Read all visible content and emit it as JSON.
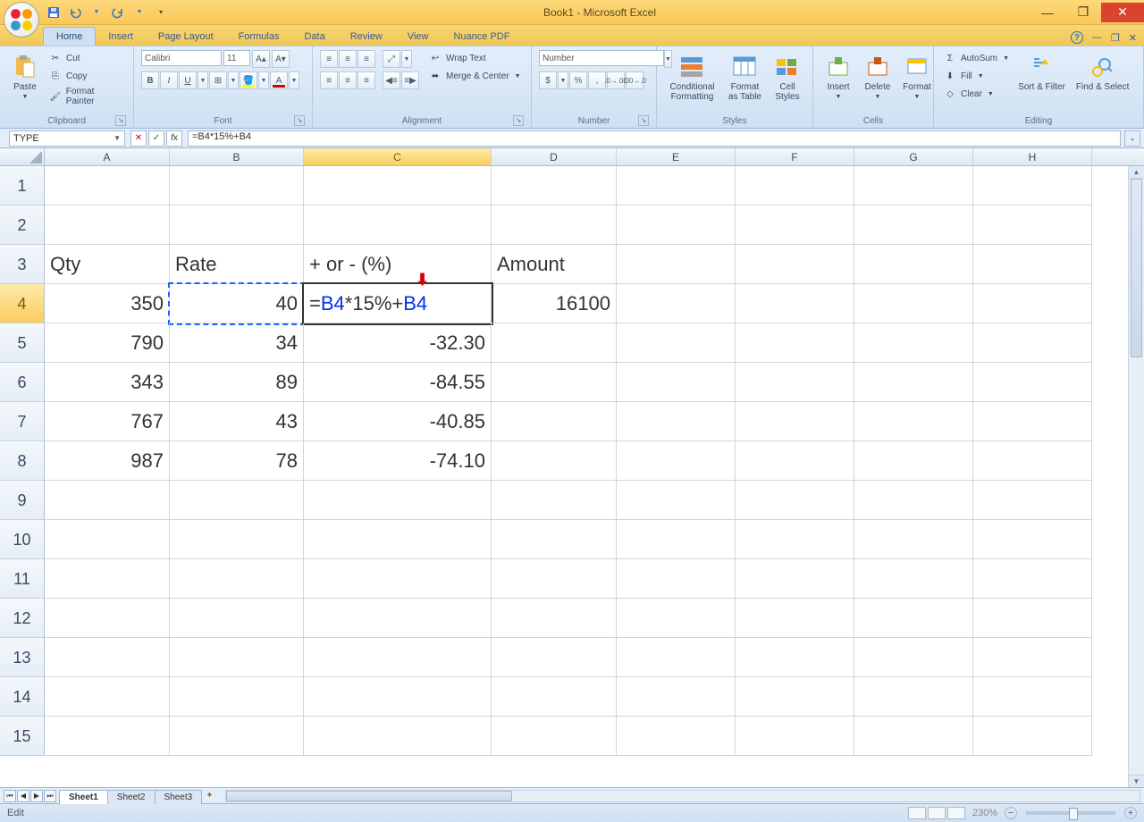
{
  "title": "Book1 - Microsoft Excel",
  "tabs": [
    "Home",
    "Insert",
    "Page Layout",
    "Formulas",
    "Data",
    "Review",
    "View",
    "Nuance PDF"
  ],
  "active_tab": "Home",
  "clipboard": {
    "cut": "Cut",
    "copy": "Copy",
    "format_painter": "Format Painter",
    "paste": "Paste",
    "label": "Clipboard"
  },
  "font": {
    "name": "Calibri",
    "size": "11",
    "label": "Font"
  },
  "alignment": {
    "wrap": "Wrap Text",
    "merge": "Merge & Center",
    "label": "Alignment"
  },
  "number": {
    "format": "Number",
    "label": "Number"
  },
  "styles": {
    "cond": "Conditional Formatting",
    "fmt": "Format as Table",
    "cell": "Cell Styles",
    "label": "Styles"
  },
  "cells": {
    "insert": "Insert",
    "delete": "Delete",
    "format": "Format",
    "label": "Cells"
  },
  "editing": {
    "autosum": "AutoSum",
    "fill": "Fill",
    "clear": "Clear",
    "sort": "Sort & Filter",
    "find": "Find & Select",
    "label": "Editing"
  },
  "namebox": "TYPE",
  "formula": "=B4*15%+B4",
  "columns": [
    "A",
    "B",
    "C",
    "D",
    "E",
    "F",
    "G",
    "H"
  ],
  "row_ids": [
    "1",
    "2",
    "3",
    "4",
    "5",
    "6",
    "7",
    "8",
    "9",
    "10",
    "11",
    "12",
    "13",
    "14",
    "15"
  ],
  "headers_row3": {
    "A": "Qty",
    "B": "Rate",
    "C": "+ or - (%)",
    "D": "Amount"
  },
  "data": {
    "4": {
      "A": "350",
      "B": "40",
      "C": "=B4*15%+B4",
      "D": "16100"
    },
    "5": {
      "A": "790",
      "B": "34",
      "C": "-32.30"
    },
    "6": {
      "A": "343",
      "B": "89",
      "C": "-84.55"
    },
    "7": {
      "A": "767",
      "B": "43",
      "C": "-40.85"
    },
    "8": {
      "A": "987",
      "B": "78",
      "C": "-74.10"
    }
  },
  "sheets": [
    "Sheet1",
    "Sheet2",
    "Sheet3"
  ],
  "status": "Edit",
  "zoom": "230%"
}
